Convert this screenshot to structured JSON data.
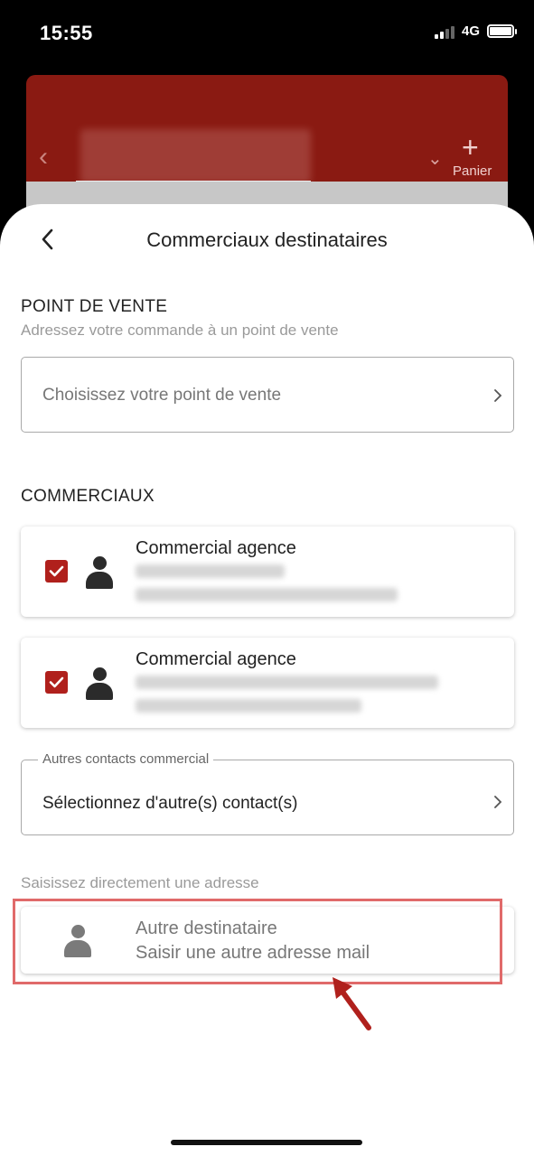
{
  "status_bar": {
    "time": "15:55",
    "network": "4G"
  },
  "background": {
    "panier_label": "Panier"
  },
  "header": {
    "title": "Commerciaux destinataires"
  },
  "point_de_vente": {
    "title": "POINT DE VENTE",
    "subtitle": "Adressez votre commande à un point de vente",
    "placeholder": "Choisissez votre point de vente"
  },
  "commerciaux": {
    "title": "COMMERCIAUX",
    "contacts": [
      {
        "title": "Commercial agence",
        "checked": true
      },
      {
        "title": "Commercial agence",
        "checked": true
      }
    ]
  },
  "autres_contacts": {
    "label": "Autres contacts commercial",
    "value": "Sélectionnez d'autre(s) contact(s)"
  },
  "direct": {
    "subtitle": "Saisissez directement une adresse",
    "title": "Autre destinataire",
    "description": "Saisir une autre adresse mail"
  },
  "colors": {
    "brand_red": "#8a1a12",
    "checkbox_red": "#b0201c",
    "annotation_red": "#e06a6a"
  },
  "icons": [
    "back-chevron-icon",
    "chevron-right-icon",
    "checkbox-checked-icon",
    "person-icon",
    "annotation-arrow-icon"
  ]
}
